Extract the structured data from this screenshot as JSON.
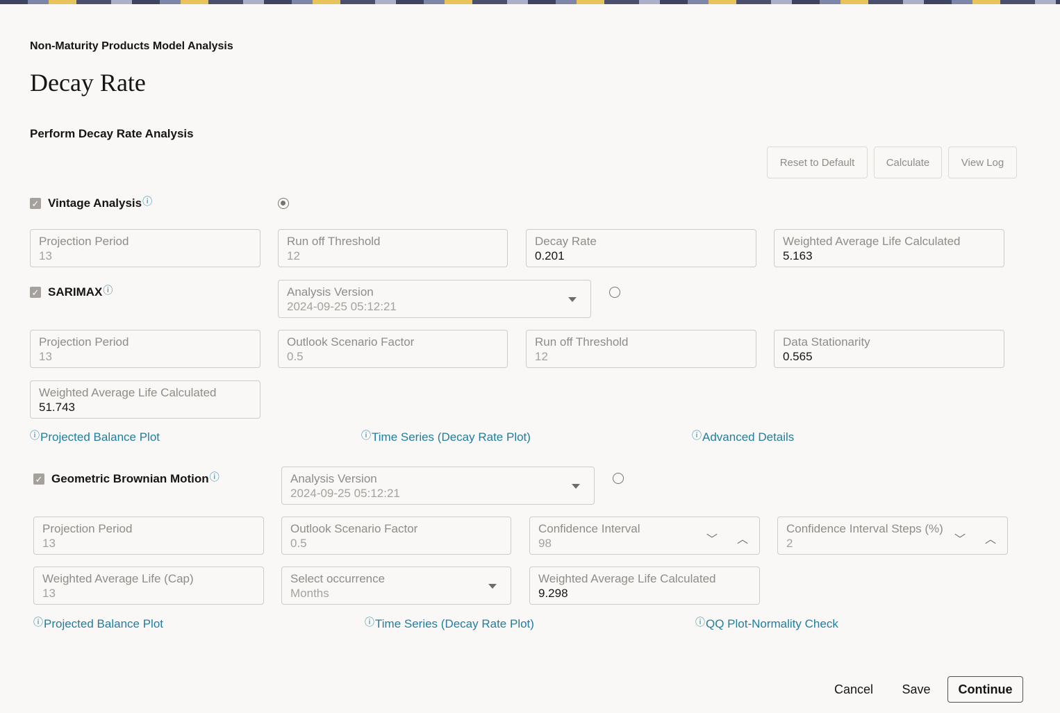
{
  "header": {
    "breadcrumb": "Non-Maturity Products Model Analysis",
    "title": "Decay Rate",
    "subtitle": "Perform Decay Rate Analysis"
  },
  "toolbar": {
    "reset": "Reset to Default",
    "calculate": "Calculate",
    "view_log": "View Log"
  },
  "info_glyph": "ⓘ",
  "vintage": {
    "label": "Vintage Analysis",
    "checked": true,
    "selected": true,
    "fields": [
      {
        "label": "Projection Period",
        "value": "13"
      },
      {
        "label": "Run off Threshold",
        "value": "12"
      },
      {
        "label": "Decay Rate",
        "value": "0.201"
      },
      {
        "label": "Weighted Average Life Calculated",
        "value": "5.163"
      }
    ]
  },
  "sarimax": {
    "label": "SARIMAX",
    "checked": true,
    "analysis_version": {
      "label": "Analysis Version",
      "value": "2024-09-25 05:12:21"
    },
    "fields": [
      {
        "label": "Projection Period",
        "value": "13"
      },
      {
        "label": "Outlook Scenario Factor",
        "value": "0.5"
      },
      {
        "label": "Run off Threshold",
        "value": "12"
      },
      {
        "label": "Data Stationarity",
        "value": "0.565"
      },
      {
        "label": "Weighted Average Life Calculated",
        "value": "51.743"
      }
    ],
    "links": [
      "Projected Balance Plot",
      "Time Series (Decay Rate Plot)",
      "Advanced Details"
    ]
  },
  "gbm": {
    "label": "Geometric Brownian Motion",
    "checked": true,
    "analysis_version": {
      "label": "Analysis Version",
      "value": "2024-09-25 05:12:21"
    },
    "fields": [
      {
        "label": "Projection Period",
        "value": "13"
      },
      {
        "label": "Outlook Scenario Factor",
        "value": "0.5"
      },
      {
        "label": "Confidence Interval",
        "value": "98"
      },
      {
        "label": "Confidence Interval Steps (%)",
        "value": "2"
      },
      {
        "label": "Weighted Average Life (Cap)",
        "value": "13"
      },
      {
        "label": "Select occurrence",
        "value": "Months"
      },
      {
        "label": "Weighted Average Life Calculated",
        "value": "9.298"
      }
    ],
    "links": [
      "Projected Balance Plot",
      "Time Series (Decay Rate Plot)",
      "QQ Plot-Normality Check"
    ]
  },
  "footer": {
    "cancel": "Cancel",
    "save": "Save",
    "continue": "Continue"
  }
}
